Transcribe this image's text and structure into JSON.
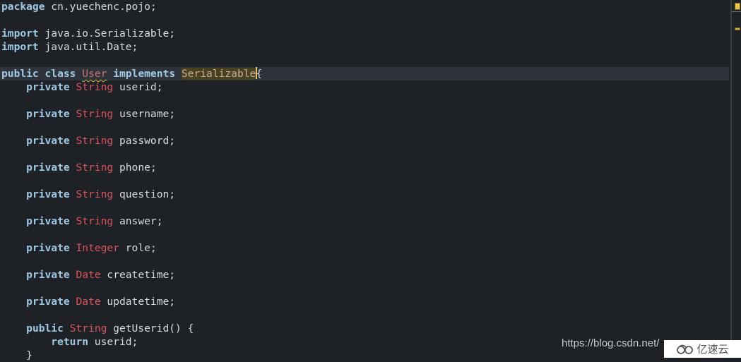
{
  "editor": {
    "lines": [
      {
        "tokens": [
          {
            "t": "package",
            "c": "kw"
          },
          {
            "t": " cn.yuechenc.pojo;",
            "c": "ident"
          }
        ]
      },
      {
        "tokens": []
      },
      {
        "tokens": [
          {
            "t": "import",
            "c": "kw"
          },
          {
            "t": " java.io.Serializable;",
            "c": "ident"
          }
        ]
      },
      {
        "tokens": [
          {
            "t": "import",
            "c": "kw"
          },
          {
            "t": " java.util.Date;",
            "c": "ident"
          }
        ]
      },
      {
        "tokens": []
      },
      {
        "current": true,
        "tokens": [
          {
            "t": "public",
            "c": "kw"
          },
          {
            "t": " ",
            "c": "ident"
          },
          {
            "t": "class",
            "c": "kw"
          },
          {
            "t": " ",
            "c": "ident"
          },
          {
            "t": "User",
            "c": "cls"
          },
          {
            "t": " ",
            "c": "ident"
          },
          {
            "t": "implements",
            "c": "kw"
          },
          {
            "t": " ",
            "c": "ident"
          },
          {
            "t": "Serializable",
            "c": "hl"
          },
          {
            "t": "|",
            "c": "cursor"
          },
          {
            "t": "{",
            "c": "brace-hl"
          }
        ]
      },
      {
        "tokens": [
          {
            "t": "    ",
            "c": "ident"
          },
          {
            "t": "private",
            "c": "kw"
          },
          {
            "t": " ",
            "c": "ident"
          },
          {
            "t": "String",
            "c": "type"
          },
          {
            "t": " userid;",
            "c": "ident"
          }
        ]
      },
      {
        "tokens": []
      },
      {
        "tokens": [
          {
            "t": "    ",
            "c": "ident"
          },
          {
            "t": "private",
            "c": "kw"
          },
          {
            "t": " ",
            "c": "ident"
          },
          {
            "t": "String",
            "c": "type"
          },
          {
            "t": " username;",
            "c": "ident"
          }
        ]
      },
      {
        "tokens": []
      },
      {
        "tokens": [
          {
            "t": "    ",
            "c": "ident"
          },
          {
            "t": "private",
            "c": "kw"
          },
          {
            "t": " ",
            "c": "ident"
          },
          {
            "t": "String",
            "c": "type"
          },
          {
            "t": " password;",
            "c": "ident"
          }
        ]
      },
      {
        "tokens": []
      },
      {
        "tokens": [
          {
            "t": "    ",
            "c": "ident"
          },
          {
            "t": "private",
            "c": "kw"
          },
          {
            "t": " ",
            "c": "ident"
          },
          {
            "t": "String",
            "c": "type"
          },
          {
            "t": " phone;",
            "c": "ident"
          }
        ]
      },
      {
        "tokens": []
      },
      {
        "tokens": [
          {
            "t": "    ",
            "c": "ident"
          },
          {
            "t": "private",
            "c": "kw"
          },
          {
            "t": " ",
            "c": "ident"
          },
          {
            "t": "String",
            "c": "type"
          },
          {
            "t": " question;",
            "c": "ident"
          }
        ]
      },
      {
        "tokens": []
      },
      {
        "tokens": [
          {
            "t": "    ",
            "c": "ident"
          },
          {
            "t": "private",
            "c": "kw"
          },
          {
            "t": " ",
            "c": "ident"
          },
          {
            "t": "String",
            "c": "type"
          },
          {
            "t": " answer;",
            "c": "ident"
          }
        ]
      },
      {
        "tokens": []
      },
      {
        "tokens": [
          {
            "t": "    ",
            "c": "ident"
          },
          {
            "t": "private",
            "c": "kw"
          },
          {
            "t": " ",
            "c": "ident"
          },
          {
            "t": "Integer",
            "c": "type"
          },
          {
            "t": " role;",
            "c": "ident"
          }
        ]
      },
      {
        "tokens": []
      },
      {
        "tokens": [
          {
            "t": "    ",
            "c": "ident"
          },
          {
            "t": "private",
            "c": "kw"
          },
          {
            "t": " ",
            "c": "ident"
          },
          {
            "t": "Date",
            "c": "type"
          },
          {
            "t": " createtime;",
            "c": "ident"
          }
        ]
      },
      {
        "tokens": []
      },
      {
        "tokens": [
          {
            "t": "    ",
            "c": "ident"
          },
          {
            "t": "private",
            "c": "kw"
          },
          {
            "t": " ",
            "c": "ident"
          },
          {
            "t": "Date",
            "c": "type"
          },
          {
            "t": " updatetime;",
            "c": "ident"
          }
        ]
      },
      {
        "tokens": []
      },
      {
        "tokens": [
          {
            "t": "    ",
            "c": "ident"
          },
          {
            "t": "public",
            "c": "kw"
          },
          {
            "t": " ",
            "c": "ident"
          },
          {
            "t": "String",
            "c": "type"
          },
          {
            "t": " getUserid() {",
            "c": "ident"
          }
        ]
      },
      {
        "tokens": [
          {
            "t": "        ",
            "c": "ident"
          },
          {
            "t": "return",
            "c": "kw"
          },
          {
            "t": " userid;",
            "c": "ident"
          }
        ]
      },
      {
        "tokens": [
          {
            "t": "    }",
            "c": "ident"
          }
        ]
      }
    ],
    "colors": {
      "background": "#1e2126",
      "keyword": "#9fcae4",
      "type": "#d9545f",
      "identifier": "#d6dbe3",
      "occurrence_highlight": "#48431c",
      "current_line": "#2e333b",
      "warning_marker": "#e8c53a"
    }
  },
  "watermark": {
    "url": "https://blog.csdn.net/",
    "logo_text": "亿速云",
    "logo_icon": "cloud-icon"
  }
}
